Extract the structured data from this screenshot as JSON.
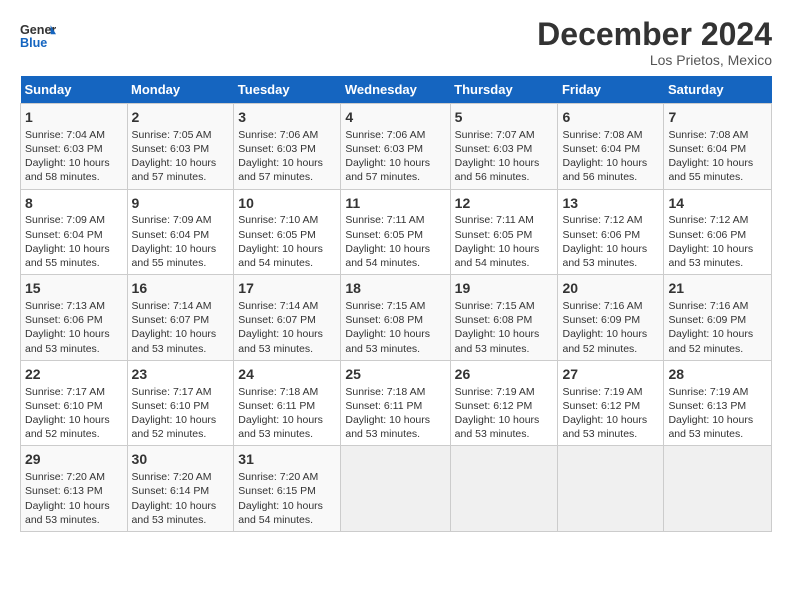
{
  "logo": {
    "line1": "General",
    "line2": "Blue"
  },
  "title": "December 2024",
  "location": "Los Prietos, Mexico",
  "days_header": [
    "Sunday",
    "Monday",
    "Tuesday",
    "Wednesday",
    "Thursday",
    "Friday",
    "Saturday"
  ],
  "weeks": [
    [
      {
        "day": 1,
        "sunrise": "7:04 AM",
        "sunset": "6:03 PM",
        "daylight": "10 hours and 58 minutes."
      },
      {
        "day": 2,
        "sunrise": "7:05 AM",
        "sunset": "6:03 PM",
        "daylight": "10 hours and 57 minutes."
      },
      {
        "day": 3,
        "sunrise": "7:06 AM",
        "sunset": "6:03 PM",
        "daylight": "10 hours and 57 minutes."
      },
      {
        "day": 4,
        "sunrise": "7:06 AM",
        "sunset": "6:03 PM",
        "daylight": "10 hours and 57 minutes."
      },
      {
        "day": 5,
        "sunrise": "7:07 AM",
        "sunset": "6:03 PM",
        "daylight": "10 hours and 56 minutes."
      },
      {
        "day": 6,
        "sunrise": "7:08 AM",
        "sunset": "6:04 PM",
        "daylight": "10 hours and 56 minutes."
      },
      {
        "day": 7,
        "sunrise": "7:08 AM",
        "sunset": "6:04 PM",
        "daylight": "10 hours and 55 minutes."
      }
    ],
    [
      {
        "day": 8,
        "sunrise": "7:09 AM",
        "sunset": "6:04 PM",
        "daylight": "10 hours and 55 minutes."
      },
      {
        "day": 9,
        "sunrise": "7:09 AM",
        "sunset": "6:04 PM",
        "daylight": "10 hours and 55 minutes."
      },
      {
        "day": 10,
        "sunrise": "7:10 AM",
        "sunset": "6:05 PM",
        "daylight": "10 hours and 54 minutes."
      },
      {
        "day": 11,
        "sunrise": "7:11 AM",
        "sunset": "6:05 PM",
        "daylight": "10 hours and 54 minutes."
      },
      {
        "day": 12,
        "sunrise": "7:11 AM",
        "sunset": "6:05 PM",
        "daylight": "10 hours and 54 minutes."
      },
      {
        "day": 13,
        "sunrise": "7:12 AM",
        "sunset": "6:06 PM",
        "daylight": "10 hours and 53 minutes."
      },
      {
        "day": 14,
        "sunrise": "7:12 AM",
        "sunset": "6:06 PM",
        "daylight": "10 hours and 53 minutes."
      }
    ],
    [
      {
        "day": 15,
        "sunrise": "7:13 AM",
        "sunset": "6:06 PM",
        "daylight": "10 hours and 53 minutes."
      },
      {
        "day": 16,
        "sunrise": "7:14 AM",
        "sunset": "6:07 PM",
        "daylight": "10 hours and 53 minutes."
      },
      {
        "day": 17,
        "sunrise": "7:14 AM",
        "sunset": "6:07 PM",
        "daylight": "10 hours and 53 minutes."
      },
      {
        "day": 18,
        "sunrise": "7:15 AM",
        "sunset": "6:08 PM",
        "daylight": "10 hours and 53 minutes."
      },
      {
        "day": 19,
        "sunrise": "7:15 AM",
        "sunset": "6:08 PM",
        "daylight": "10 hours and 53 minutes."
      },
      {
        "day": 20,
        "sunrise": "7:16 AM",
        "sunset": "6:09 PM",
        "daylight": "10 hours and 52 minutes."
      },
      {
        "day": 21,
        "sunrise": "7:16 AM",
        "sunset": "6:09 PM",
        "daylight": "10 hours and 52 minutes."
      }
    ],
    [
      {
        "day": 22,
        "sunrise": "7:17 AM",
        "sunset": "6:10 PM",
        "daylight": "10 hours and 52 minutes."
      },
      {
        "day": 23,
        "sunrise": "7:17 AM",
        "sunset": "6:10 PM",
        "daylight": "10 hours and 52 minutes."
      },
      {
        "day": 24,
        "sunrise": "7:18 AM",
        "sunset": "6:11 PM",
        "daylight": "10 hours and 53 minutes."
      },
      {
        "day": 25,
        "sunrise": "7:18 AM",
        "sunset": "6:11 PM",
        "daylight": "10 hours and 53 minutes."
      },
      {
        "day": 26,
        "sunrise": "7:19 AM",
        "sunset": "6:12 PM",
        "daylight": "10 hours and 53 minutes."
      },
      {
        "day": 27,
        "sunrise": "7:19 AM",
        "sunset": "6:12 PM",
        "daylight": "10 hours and 53 minutes."
      },
      {
        "day": 28,
        "sunrise": "7:19 AM",
        "sunset": "6:13 PM",
        "daylight": "10 hours and 53 minutes."
      }
    ],
    [
      {
        "day": 29,
        "sunrise": "7:20 AM",
        "sunset": "6:13 PM",
        "daylight": "10 hours and 53 minutes."
      },
      {
        "day": 30,
        "sunrise": "7:20 AM",
        "sunset": "6:14 PM",
        "daylight": "10 hours and 53 minutes."
      },
      {
        "day": 31,
        "sunrise": "7:20 AM",
        "sunset": "6:15 PM",
        "daylight": "10 hours and 54 minutes."
      },
      null,
      null,
      null,
      null
    ]
  ]
}
